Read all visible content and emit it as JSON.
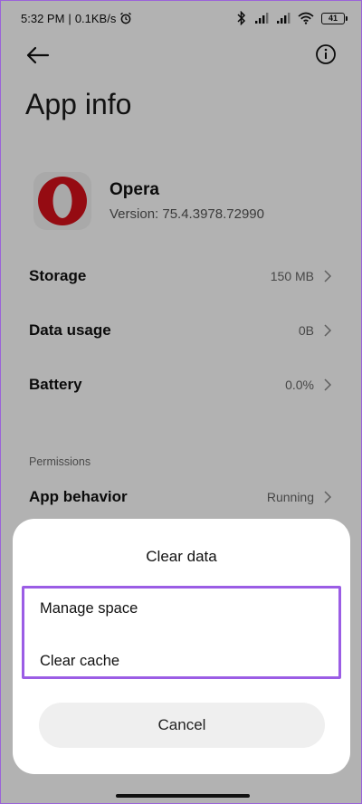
{
  "status_bar": {
    "time": "5:32 PM",
    "network_speed": "0.1KB/s",
    "battery": "41",
    "icons": [
      "alarm-icon",
      "bluetooth-icon",
      "signal-icon",
      "signal-icon",
      "wifi-icon",
      "battery-icon"
    ]
  },
  "header": {
    "title": "App info"
  },
  "app": {
    "name": "Opera",
    "version": "Version: 75.4.3978.72990",
    "icon": "opera-logo-icon"
  },
  "rows": [
    {
      "label": "Storage",
      "value": "150 MB"
    },
    {
      "label": "Data usage",
      "value": "0B"
    },
    {
      "label": "Battery",
      "value": "0.0%"
    }
  ],
  "permissions": {
    "section_label": "Permissions",
    "app_behavior": {
      "label": "App behavior",
      "value": "Running"
    }
  },
  "dialog": {
    "title": "Clear data",
    "options": [
      "Manage space",
      "Clear cache"
    ],
    "cancel_label": "Cancel",
    "highlight_color": "#9b5de5"
  }
}
